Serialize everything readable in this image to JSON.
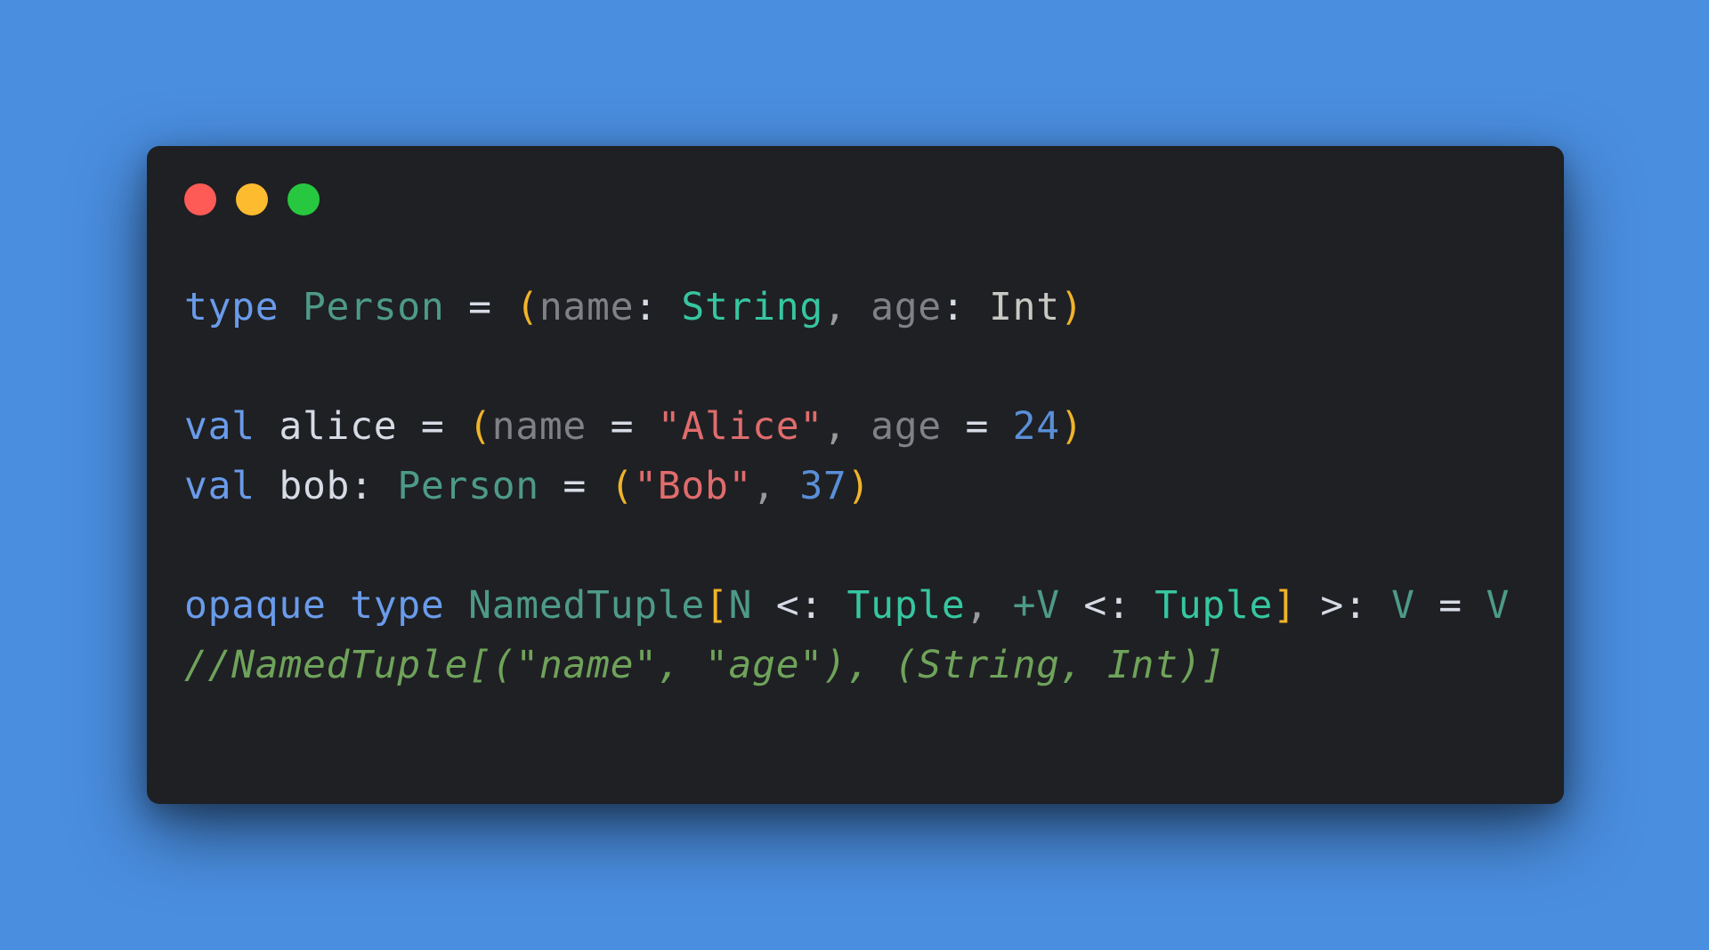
{
  "window": {
    "controls": [
      {
        "name": "close",
        "color": "#fe5b56"
      },
      {
        "name": "minimize",
        "color": "#fdbb2f"
      },
      {
        "name": "maximize",
        "color": "#27c840"
      }
    ],
    "background_color": "#1f2024",
    "page_background": "#4a8ee0"
  },
  "code": {
    "language": "scala",
    "lines": [
      [
        {
          "t": "type",
          "c": "#6a9bea"
        },
        {
          "t": " ",
          "c": "#d6dbe5"
        },
        {
          "t": "Person",
          "c": "#4d9a88"
        },
        {
          "t": " = ",
          "c": "#d6dbe5"
        },
        {
          "t": "(",
          "c": "#f0b429"
        },
        {
          "t": "name",
          "c": "#7f8186"
        },
        {
          "t": ": ",
          "c": "#d6dbe5"
        },
        {
          "t": "String",
          "c": "#36c6a0"
        },
        {
          "t": ", ",
          "c": "#9a9a9a"
        },
        {
          "t": "age",
          "c": "#7f8186"
        },
        {
          "t": ": ",
          "c": "#d6dbe5"
        },
        {
          "t": "Int",
          "c": "#c9c9c4"
        },
        {
          "t": ")",
          "c": "#f0b429"
        }
      ],
      [],
      [
        {
          "t": "val",
          "c": "#6a9bea"
        },
        {
          "t": " ",
          "c": "#d6dbe5"
        },
        {
          "t": "alice",
          "c": "#d6dbe5"
        },
        {
          "t": " = ",
          "c": "#d6dbe5"
        },
        {
          "t": "(",
          "c": "#f0b429"
        },
        {
          "t": "name",
          "c": "#7f8186"
        },
        {
          "t": " = ",
          "c": "#d6dbe5"
        },
        {
          "t": "\"Alice\"",
          "c": "#e06c6c"
        },
        {
          "t": ", ",
          "c": "#9a9a9a"
        },
        {
          "t": "age",
          "c": "#7f8186"
        },
        {
          "t": " = ",
          "c": "#d6dbe5"
        },
        {
          "t": "24",
          "c": "#5a8fd8"
        },
        {
          "t": ")",
          "c": "#f0b429"
        }
      ],
      [
        {
          "t": "val",
          "c": "#6a9bea"
        },
        {
          "t": " ",
          "c": "#d6dbe5"
        },
        {
          "t": "bob",
          "c": "#d6dbe5"
        },
        {
          "t": ": ",
          "c": "#d6dbe5"
        },
        {
          "t": "Person",
          "c": "#4d9a88"
        },
        {
          "t": " = ",
          "c": "#d6dbe5"
        },
        {
          "t": "(",
          "c": "#f0b429"
        },
        {
          "t": "\"Bob\"",
          "c": "#e06c6c"
        },
        {
          "t": ", ",
          "c": "#9a9a9a"
        },
        {
          "t": "37",
          "c": "#5a8fd8"
        },
        {
          "t": ")",
          "c": "#f0b429"
        }
      ],
      [],
      [
        {
          "t": "opaque",
          "c": "#6a9bea"
        },
        {
          "t": " ",
          "c": "#d6dbe5"
        },
        {
          "t": "type",
          "c": "#6a9bea"
        },
        {
          "t": " ",
          "c": "#d6dbe5"
        },
        {
          "t": "NamedTuple",
          "c": "#4d9a88"
        },
        {
          "t": "[",
          "c": "#f0b429"
        },
        {
          "t": "N",
          "c": "#4d9a88"
        },
        {
          "t": " <: ",
          "c": "#d6dbe5"
        },
        {
          "t": "Tuple",
          "c": "#36c6a0"
        },
        {
          "t": ", ",
          "c": "#9a9a9a"
        },
        {
          "t": "+V",
          "c": "#4d9a88"
        },
        {
          "t": " <: ",
          "c": "#d6dbe5"
        },
        {
          "t": "Tuple",
          "c": "#36c6a0"
        },
        {
          "t": "]",
          "c": "#f0b429"
        },
        {
          "t": " >: ",
          "c": "#d6dbe5"
        },
        {
          "t": "V",
          "c": "#4d9a88"
        },
        {
          "t": " = ",
          "c": "#d6dbe5"
        },
        {
          "t": "V",
          "c": "#4d9a88"
        }
      ],
      [
        {
          "t": "//NamedTuple[(\"name\", \"age\"), (String, Int)]",
          "c": "#6fa35a",
          "italic": true
        }
      ]
    ]
  }
}
